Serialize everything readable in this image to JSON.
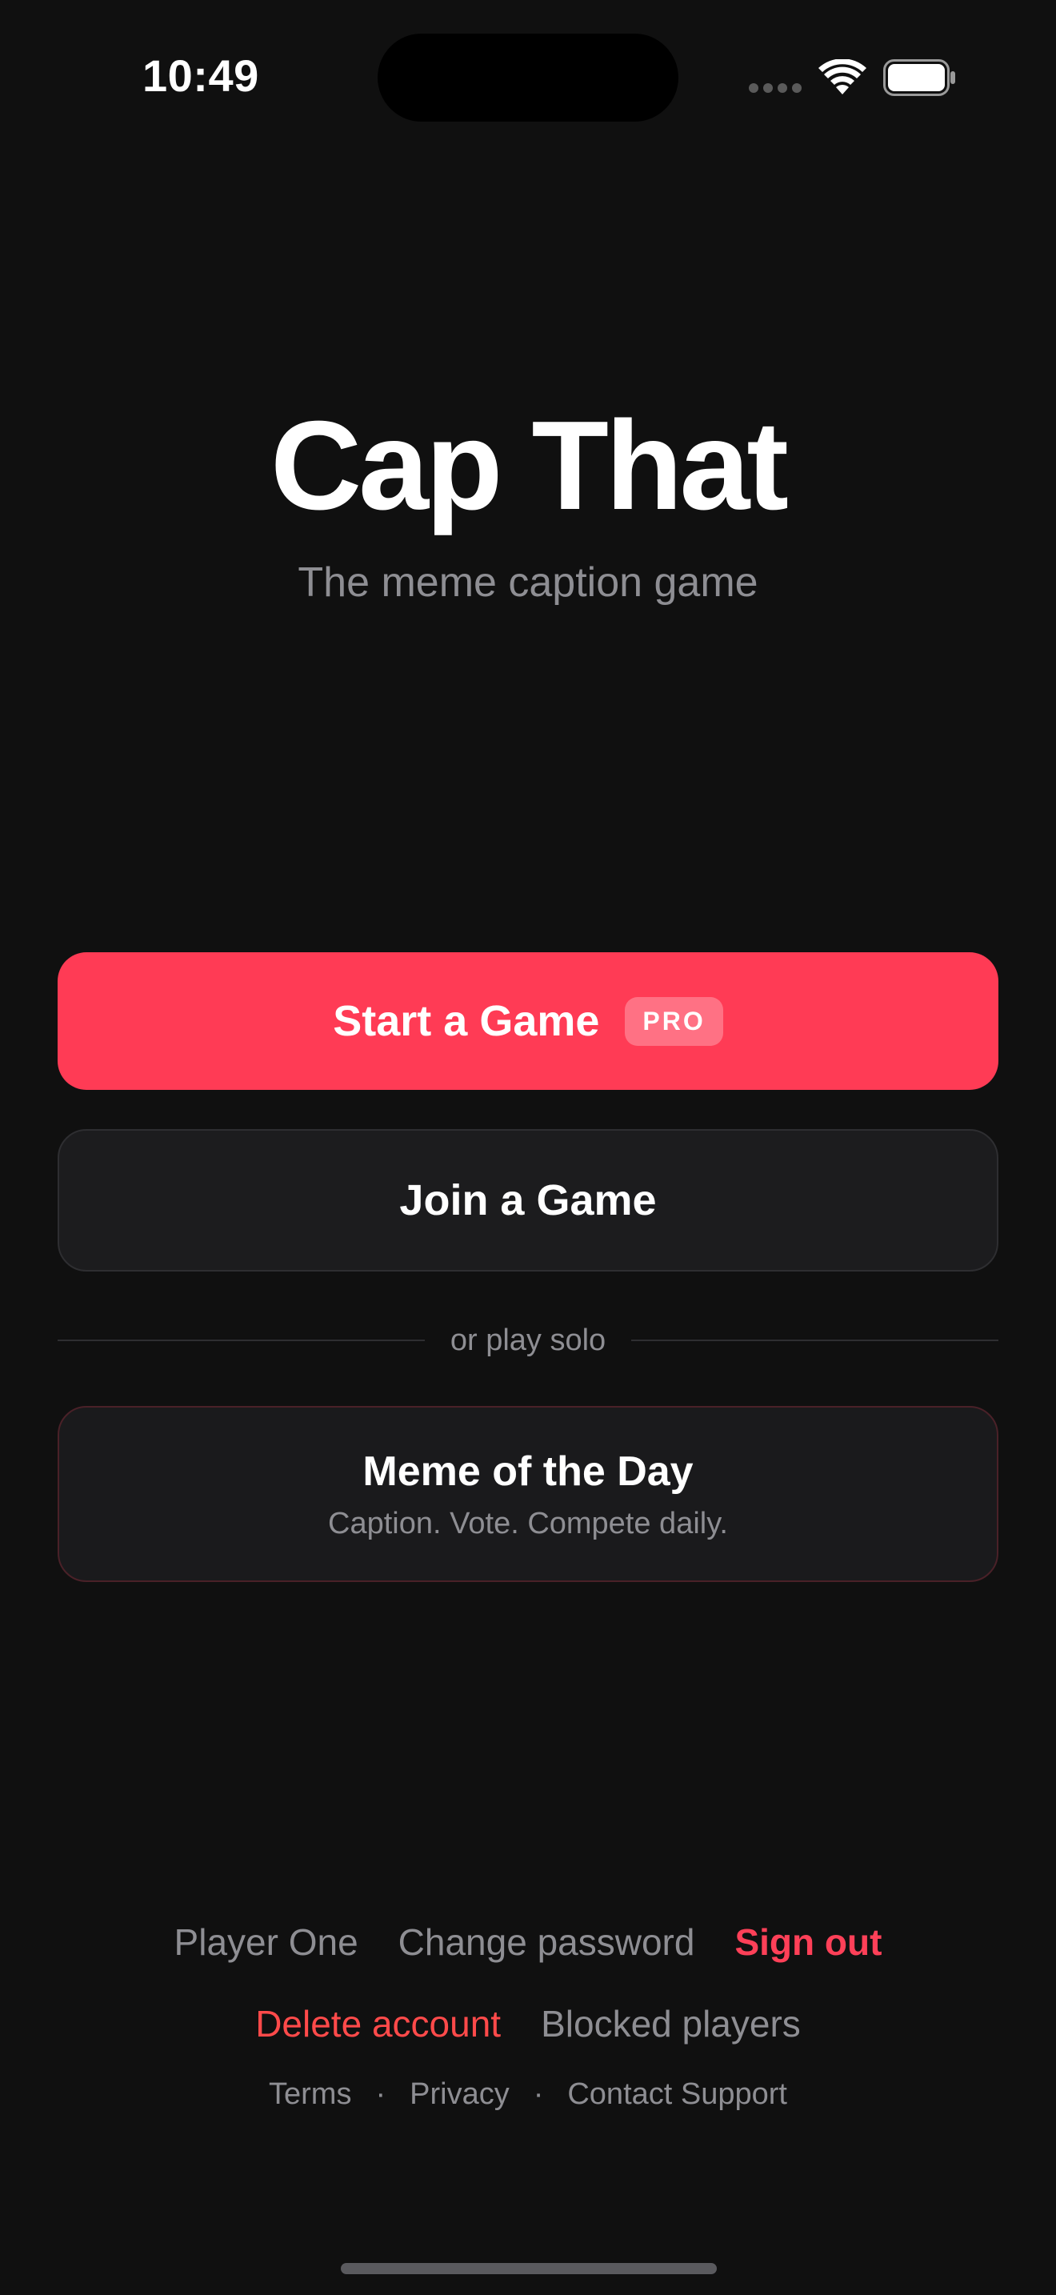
{
  "status_bar": {
    "time": "10:49"
  },
  "app": {
    "title": "Cap That",
    "subtitle": "The meme caption game"
  },
  "actions": {
    "start_game_label": "Start a Game",
    "pro_badge": "PRO",
    "join_game_label": "Join a Game",
    "divider_text": "or play solo",
    "motd_title": "Meme of the Day",
    "motd_subtitle": "Caption. Vote. Compete daily."
  },
  "footer": {
    "player_name": "Player One",
    "change_password": "Change password",
    "sign_out": "Sign out",
    "delete_account": "Delete account",
    "blocked_players": "Blocked players",
    "terms": "Terms",
    "privacy": "Privacy",
    "contact_support": "Contact Support",
    "separator": "·"
  },
  "icons": {
    "signal": "cellular-signal-icon",
    "wifi": "wifi-icon",
    "battery": "battery-icon"
  },
  "colors": {
    "background": "#101010",
    "accent": "#ff3b55",
    "card": "#1c1c1e",
    "muted_text": "#8e8e93",
    "danger": "#ff4a4a"
  }
}
